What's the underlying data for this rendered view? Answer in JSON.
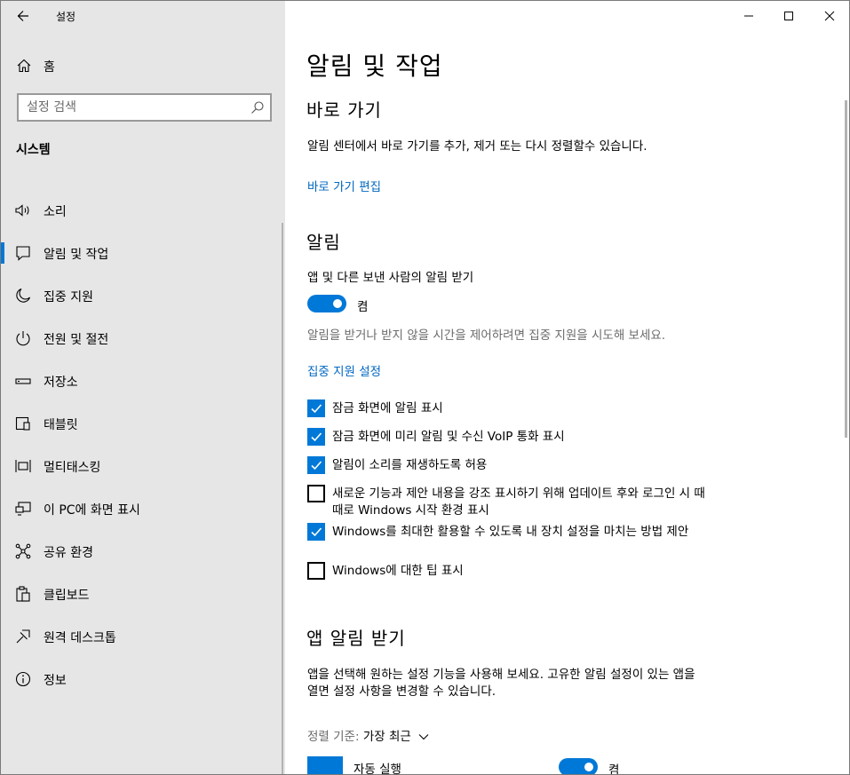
{
  "window": {
    "title": "설정"
  },
  "sidebar": {
    "home_label": "홈",
    "search_placeholder": "설정 검색",
    "section_title": "시스템",
    "items": [
      {
        "label": "소리",
        "icon": "speaker-icon"
      },
      {
        "label": "알림 및 작업",
        "icon": "notification-icon",
        "active": true
      },
      {
        "label": "집중 지원",
        "icon": "moon-icon"
      },
      {
        "label": "전원 및 절전",
        "icon": "power-icon"
      },
      {
        "label": "저장소",
        "icon": "storage-icon"
      },
      {
        "label": "태블릿",
        "icon": "tablet-icon"
      },
      {
        "label": "멀티태스킹",
        "icon": "multitasking-icon"
      },
      {
        "label": "이 PC에 화면 표시",
        "icon": "project-icon"
      },
      {
        "label": "공유 환경",
        "icon": "shared-experiences-icon"
      },
      {
        "label": "클립보드",
        "icon": "clipboard-icon"
      },
      {
        "label": "원격 데스크톱",
        "icon": "remote-desktop-icon"
      },
      {
        "label": "정보",
        "icon": "info-icon"
      }
    ]
  },
  "main": {
    "page_title": "알림 및 작업",
    "shortcuts": {
      "heading": "바로 가기",
      "description": "알림 센터에서 바로 가기를 추가, 제거 또는 다시 정렬할수 있습니다.",
      "edit_link": "바로 가기 편집"
    },
    "notifications": {
      "heading": "알림",
      "toggle_caption": "앱 및 다른 보낸 사람의 알림 받기",
      "toggle_state": "켬",
      "focus_hint": "알림을 받거나 받지 않을 시간을 제어하려면 집중 지원을 시도해 보세요.",
      "focus_link": "집중 지원 설정",
      "checkboxes": [
        {
          "label": "잠금 화면에 알림 표시",
          "checked": true
        },
        {
          "label": "잠금 화면에 미리 알림 및 수신 VoIP 통화 표시",
          "checked": true
        },
        {
          "label": "알림이 소리를 재생하도록 허용",
          "checked": true
        },
        {
          "label": "새로운 기능과 제안 내용을 강조 표시하기 위해 업데이트 후와 로그인 시 때때로 Windows 시작 환경 표시",
          "checked": false
        },
        {
          "label": "Windows를 최대한 활용할 수 있도록 내 장치 설정을 마치는 방법 제안",
          "checked": true
        },
        {
          "label": "Windows에 대한 팁 표시",
          "checked": false
        }
      ]
    },
    "app_notifications": {
      "heading": "앱 알림 받기",
      "description": "앱을 선택해 원하는 설정 기능을 사용해 보세요. 고유한 알림 설정이 있는 앱을 열면 설정 사항을 변경할 수 있습니다.",
      "sort_label": "정렬 기준:",
      "sort_value": "가장 최근",
      "apps": [
        {
          "name": "자동 실행",
          "state": "켬"
        }
      ]
    }
  },
  "colors": {
    "accent": "#0078d7",
    "link": "#0067c0",
    "sidebar_bg": "#e6e6e6"
  }
}
